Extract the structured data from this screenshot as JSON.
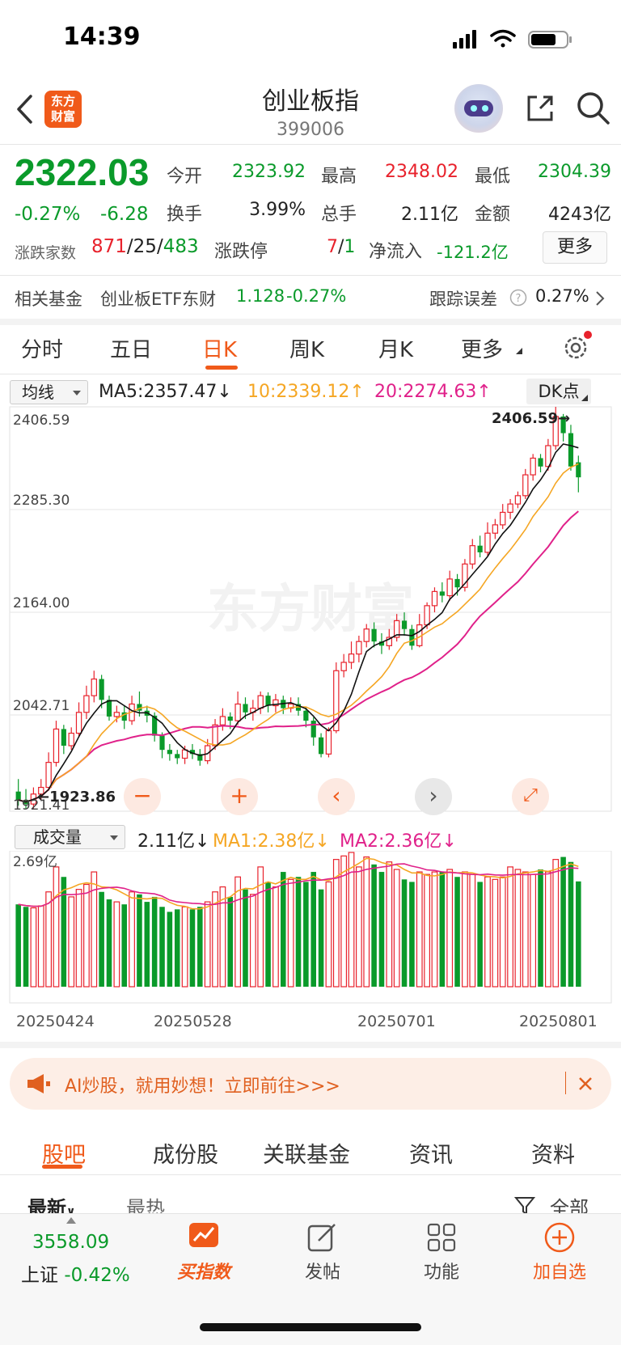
{
  "status_bar": {
    "time": "14:39"
  },
  "header": {
    "title": "创业板指",
    "code": "399006",
    "logo_text": "东方财富"
  },
  "quote": {
    "price": "2322.03",
    "change_pct": "-0.27%",
    "change_abs": "-6.28",
    "fields": [
      {
        "label": "今开",
        "value": "2323.92",
        "color": "green"
      },
      {
        "label": "最高",
        "value": "2348.02",
        "color": "red"
      },
      {
        "label": "最低",
        "value": "2304.39",
        "color": "green"
      },
      {
        "label": "换手",
        "value": "3.99%",
        "color": "black"
      },
      {
        "label": "总手",
        "value": "2.11亿",
        "color": "black"
      },
      {
        "label": "金额",
        "value": "4243亿",
        "color": "black"
      }
    ],
    "breadth_label": "涨跌家数",
    "breadth_up": "871",
    "breadth_flat": "25",
    "breadth_down": "483",
    "limit_label": "涨跌停",
    "limit_up": "7",
    "limit_down": "1",
    "netflow_label": "净流入",
    "netflow_value": "-121.2亿",
    "more_label": "更多"
  },
  "fund_row": {
    "label": "相关基金",
    "fund_name": "创业板ETF东财",
    "fund_price": "1.128",
    "fund_change": "-0.27%",
    "tracking_label": "跟踪误差",
    "tracking_value": "0.27%"
  },
  "period_tabs": [
    "分时",
    "五日",
    "日K",
    "周K",
    "月K",
    "更多"
  ],
  "active_period": "日K",
  "ma_bar": {
    "selector": "均线",
    "ma5": "MA5:2357.47",
    "ma10": "10:2339.12",
    "ma20": "20:2274.63",
    "dk_label": "DK点"
  },
  "price_axis": [
    "2406.59",
    "2285.30",
    "2164.00",
    "2042.71",
    "1921.41"
  ],
  "annotations": {
    "high": "2406.59",
    "low": "1923.86"
  },
  "volume_bar": {
    "selector": "成交量",
    "value": "2.11亿",
    "ma1": "MA1:2.38亿",
    "ma2": "MA2:2.36亿",
    "axis_max": "2.69亿"
  },
  "date_axis": [
    "20250424",
    "20250528",
    "20250701",
    "20250801"
  ],
  "watermark": "东方财富",
  "banner": {
    "text": "AI炒股，就用妙想！立即前往>>>"
  },
  "section_tabs": [
    "股吧",
    "成份股",
    "关联基金",
    "资讯",
    "资料"
  ],
  "sort_row": {
    "latest": "最新",
    "hot": "最热",
    "all": "全部"
  },
  "bottom_nav": {
    "index_value": "3558.09",
    "index_name": "上证",
    "index_change": "-0.42%",
    "items": [
      "买指数",
      "发帖",
      "功能",
      "加自选"
    ]
  },
  "colors": {
    "up": "#e8222c",
    "down": "#0a9a2a",
    "accent": "#f05a1a",
    "ma5": "#111111",
    "ma10": "#f5a623",
    "ma20": "#e0218a"
  },
  "chart_data": {
    "type": "candlestick",
    "x_range": [
      "20250424",
      "20250801"
    ],
    "ylim": [
      1921.41,
      2406.59
    ],
    "candles": [
      {
        "o": 1945,
        "c": 1935,
        "h": 1960,
        "l": 1928
      },
      {
        "o": 1935,
        "c": 1930,
        "h": 1948,
        "l": 1924
      },
      {
        "o": 1930,
        "c": 1942,
        "h": 1950,
        "l": 1924
      },
      {
        "o": 1942,
        "c": 1950,
        "h": 1960,
        "l": 1935
      },
      {
        "o": 1950,
        "c": 1980,
        "h": 1992,
        "l": 1946
      },
      {
        "o": 1980,
        "c": 2020,
        "h": 2030,
        "l": 1975
      },
      {
        "o": 2020,
        "c": 2000,
        "h": 2025,
        "l": 1990
      },
      {
        "o": 2000,
        "c": 2015,
        "h": 2022,
        "l": 1995
      },
      {
        "o": 2015,
        "c": 2040,
        "h": 2052,
        "l": 2010
      },
      {
        "o": 2040,
        "c": 2060,
        "h": 2072,
        "l": 2032
      },
      {
        "o": 2060,
        "c": 2080,
        "h": 2090,
        "l": 2052
      },
      {
        "o": 2080,
        "c": 2055,
        "h": 2085,
        "l": 2045
      },
      {
        "o": 2055,
        "c": 2035,
        "h": 2060,
        "l": 2030
      },
      {
        "o": 2035,
        "c": 2040,
        "h": 2048,
        "l": 2028
      },
      {
        "o": 2040,
        "c": 2030,
        "h": 2048,
        "l": 2020
      },
      {
        "o": 2030,
        "c": 2050,
        "h": 2060,
        "l": 2025
      },
      {
        "o": 2050,
        "c": 2042,
        "h": 2065,
        "l": 2035
      },
      {
        "o": 2042,
        "c": 2036,
        "h": 2048,
        "l": 2028
      },
      {
        "o": 2036,
        "c": 2012,
        "h": 2040,
        "l": 2005
      },
      {
        "o": 2012,
        "c": 1995,
        "h": 2016,
        "l": 1985
      },
      {
        "o": 1995,
        "c": 1990,
        "h": 2002,
        "l": 1982
      },
      {
        "o": 1990,
        "c": 1985,
        "h": 1995,
        "l": 1978
      },
      {
        "o": 1985,
        "c": 1995,
        "h": 2000,
        "l": 1978
      },
      {
        "o": 1995,
        "c": 1990,
        "h": 2002,
        "l": 1984
      },
      {
        "o": 1990,
        "c": 1982,
        "h": 1996,
        "l": 1976
      },
      {
        "o": 1982,
        "c": 2000,
        "h": 2008,
        "l": 1978
      },
      {
        "o": 2000,
        "c": 2025,
        "h": 2032,
        "l": 1995
      },
      {
        "o": 2025,
        "c": 2035,
        "h": 2045,
        "l": 2018
      },
      {
        "o": 2035,
        "c": 2030,
        "h": 2040,
        "l": 2020
      },
      {
        "o": 2030,
        "c": 2050,
        "h": 2065,
        "l": 2025
      },
      {
        "o": 2050,
        "c": 2040,
        "h": 2058,
        "l": 2032
      },
      {
        "o": 2040,
        "c": 2045,
        "h": 2055,
        "l": 2030
      },
      {
        "o": 2045,
        "c": 2060,
        "h": 2065,
        "l": 2038
      },
      {
        "o": 2060,
        "c": 2048,
        "h": 2064,
        "l": 2040
      },
      {
        "o": 2048,
        "c": 2055,
        "h": 2062,
        "l": 2040
      },
      {
        "o": 2055,
        "c": 2045,
        "h": 2060,
        "l": 2038
      },
      {
        "o": 2045,
        "c": 2050,
        "h": 2058,
        "l": 2040
      },
      {
        "o": 2050,
        "c": 2042,
        "h": 2058,
        "l": 2036
      },
      {
        "o": 2042,
        "c": 2030,
        "h": 2046,
        "l": 2022
      },
      {
        "o": 2030,
        "c": 2010,
        "h": 2034,
        "l": 2000
      },
      {
        "o": 2010,
        "c": 1990,
        "h": 2015,
        "l": 1986
      },
      {
        "o": 1990,
        "c": 2018,
        "h": 2022,
        "l": 1986
      },
      {
        "o": 2018,
        "c": 2090,
        "h": 2100,
        "l": 2015
      },
      {
        "o": 2090,
        "c": 2100,
        "h": 2110,
        "l": 2082
      },
      {
        "o": 2100,
        "c": 2110,
        "h": 2125,
        "l": 2092
      },
      {
        "o": 2110,
        "c": 2125,
        "h": 2132,
        "l": 2100
      },
      {
        "o": 2125,
        "c": 2140,
        "h": 2146,
        "l": 2118
      },
      {
        "o": 2140,
        "c": 2125,
        "h": 2148,
        "l": 2118
      },
      {
        "o": 2125,
        "c": 2120,
        "h": 2135,
        "l": 2110
      },
      {
        "o": 2120,
        "c": 2130,
        "h": 2140,
        "l": 2115
      },
      {
        "o": 2130,
        "c": 2150,
        "h": 2158,
        "l": 2125
      },
      {
        "o": 2150,
        "c": 2140,
        "h": 2160,
        "l": 2132
      },
      {
        "o": 2140,
        "c": 2120,
        "h": 2145,
        "l": 2115
      },
      {
        "o": 2120,
        "c": 2145,
        "h": 2158,
        "l": 2118
      },
      {
        "o": 2145,
        "c": 2168,
        "h": 2172,
        "l": 2140
      },
      {
        "o": 2168,
        "c": 2185,
        "h": 2190,
        "l": 2160
      },
      {
        "o": 2185,
        "c": 2180,
        "h": 2196,
        "l": 2172
      },
      {
        "o": 2180,
        "c": 2200,
        "h": 2210,
        "l": 2174
      },
      {
        "o": 2200,
        "c": 2190,
        "h": 2206,
        "l": 2180
      },
      {
        "o": 2190,
        "c": 2218,
        "h": 2224,
        "l": 2185
      },
      {
        "o": 2218,
        "c": 2240,
        "h": 2248,
        "l": 2212
      },
      {
        "o": 2240,
        "c": 2232,
        "h": 2252,
        "l": 2226
      },
      {
        "o": 2232,
        "c": 2255,
        "h": 2268,
        "l": 2228
      },
      {
        "o": 2255,
        "c": 2265,
        "h": 2272,
        "l": 2248
      },
      {
        "o": 2265,
        "c": 2280,
        "h": 2290,
        "l": 2260
      },
      {
        "o": 2280,
        "c": 2290,
        "h": 2296,
        "l": 2272
      },
      {
        "o": 2290,
        "c": 2300,
        "h": 2305,
        "l": 2285
      },
      {
        "o": 2300,
        "c": 2325,
        "h": 2332,
        "l": 2296
      },
      {
        "o": 2325,
        "c": 2345,
        "h": 2350,
        "l": 2318
      },
      {
        "o": 2345,
        "c": 2335,
        "h": 2350,
        "l": 2328
      },
      {
        "o": 2335,
        "c": 2360,
        "h": 2368,
        "l": 2330
      },
      {
        "o": 2360,
        "c": 2395,
        "h": 2406.59,
        "l": 2355
      },
      {
        "o": 2395,
        "c": 2375,
        "h": 2398,
        "l": 2365
      },
      {
        "o": 2375,
        "c": 2335,
        "h": 2385,
        "l": 2330
      },
      {
        "o": 2340,
        "c": 2322,
        "h": 2348,
        "l": 2304
      }
    ],
    "volumes": [
      1.65,
      1.6,
      1.58,
      1.62,
      1.9,
      2.4,
      2.2,
      1.8,
      1.95,
      2.05,
      2.3,
      1.9,
      1.75,
      1.7,
      1.65,
      1.9,
      1.85,
      1.7,
      1.8,
      1.6,
      1.5,
      1.55,
      1.6,
      1.55,
      1.6,
      1.7,
      1.9,
      2.0,
      1.8,
      2.2,
      1.95,
      1.85,
      2.4,
      2.1,
      2.0,
      2.3,
      2.15,
      2.2,
      2.1,
      2.3,
      1.95,
      2.1,
      2.55,
      2.62,
      2.69,
      2.4,
      2.6,
      2.45,
      2.3,
      2.5,
      2.35,
      2.15,
      2.1,
      2.3,
      2.25,
      2.3,
      2.3,
      2.35,
      2.2,
      2.3,
      2.25,
      2.1,
      2.2,
      2.15,
      2.2,
      2.4,
      2.35,
      2.3,
      2.25,
      2.35,
      2.3,
      2.55,
      2.6,
      2.5,
      2.11
    ]
  }
}
